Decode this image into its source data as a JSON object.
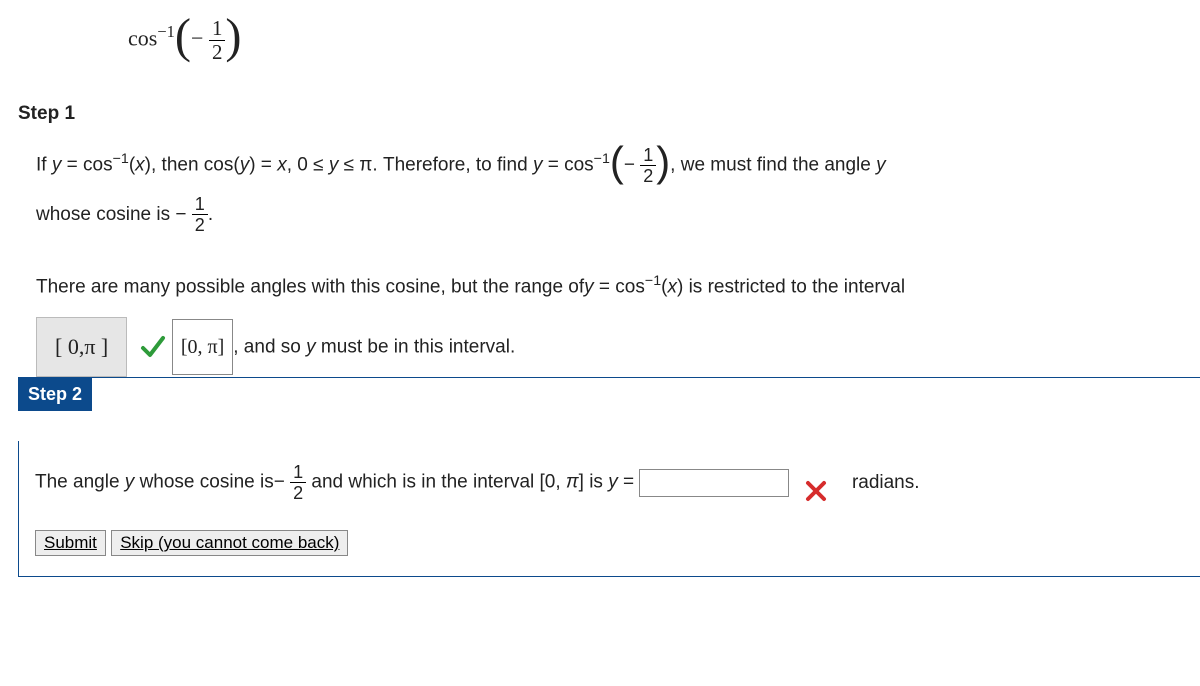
{
  "problem": {
    "func_prefix": "cos",
    "exponent": "−1",
    "arg_sign": "− ",
    "arg_frac_num": "1",
    "arg_frac_den": "2"
  },
  "step1": {
    "label": "Step 1",
    "line1a": "If ",
    "eqY": "y",
    "eqText1": " = cos",
    "exp1": "−1",
    "eqText2": "(",
    "x": "x",
    "eqText3": "), then cos(",
    "eqText4": ") = ",
    "eqText5": ", 0 ≤ ",
    "eqText6": " ≤ π. Therefore, to find ",
    "eqText7": " = cos",
    "line1b": ", we must find the angle ",
    "line2a": "whose cosine is ",
    "line2_sign": "− ",
    "frac_num": "1",
    "frac_den": "2",
    "line2b": ".",
    "line3a": "There are many possible angles with this cosine, but the range of",
    "line3b": " = cos",
    "line3c": "(",
    "line3d": ") is restricted to the interval",
    "answer_display": "[ 0,π ]",
    "correct_display": "[0, π]",
    "line4": ", and so ",
    "line4b": " must be in this interval."
  },
  "step2": {
    "label": "Step 2",
    "text_a": "The angle ",
    "text_b": " whose cosine is",
    "sign": "− ",
    "fn": "1",
    "fd": "2",
    "text_c": " and which is in the interval [0, ",
    "pi": "π",
    "text_d": "] is ",
    "eq": " = ",
    "units": " radians.",
    "input_value": ""
  },
  "buttons": {
    "submit": "Submit",
    "skip": "Skip (you cannot come back)"
  }
}
